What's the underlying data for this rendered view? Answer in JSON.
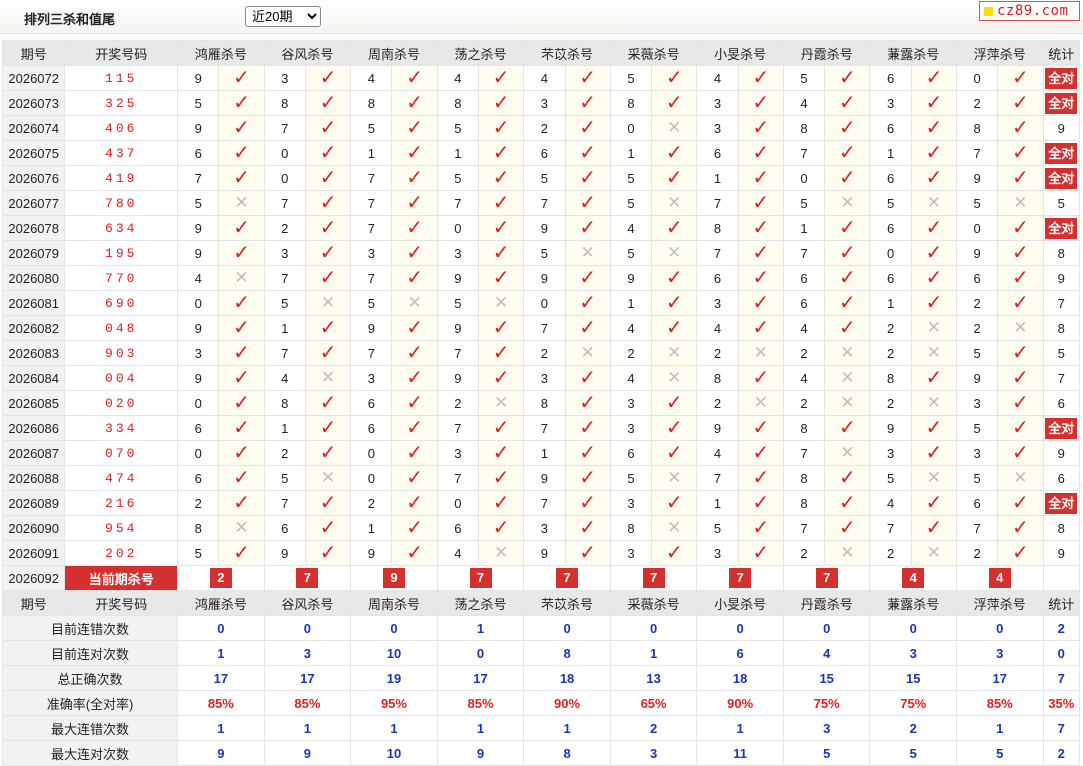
{
  "header": {
    "title": "排列三杀和值尾",
    "period_selected": "近20期",
    "period_options": [
      "近20期"
    ],
    "logo_text": "cz89.com"
  },
  "columns": {
    "issue": "期号",
    "winning": "开奖号码",
    "killers": [
      "鸿雁杀号",
      "谷风杀号",
      "周南杀号",
      "荡之杀号",
      "芣苡杀号",
      "采薇杀号",
      "小旻杀号",
      "丹霞杀号",
      "蒹露杀号",
      "浮萍杀号"
    ],
    "stats": "统计"
  },
  "rows": [
    {
      "issue": "2026072",
      "win": "115",
      "k": [
        [
          "9",
          1
        ],
        [
          "3",
          1
        ],
        [
          "4",
          1
        ],
        [
          "4",
          1
        ],
        [
          "4",
          1
        ],
        [
          "5",
          1
        ],
        [
          "4",
          1
        ],
        [
          "5",
          1
        ],
        [
          "6",
          1
        ],
        [
          "0",
          1
        ]
      ],
      "stat": "全对"
    },
    {
      "issue": "2026073",
      "win": "325",
      "k": [
        [
          "5",
          1
        ],
        [
          "8",
          1
        ],
        [
          "8",
          1
        ],
        [
          "8",
          1
        ],
        [
          "3",
          1
        ],
        [
          "8",
          1
        ],
        [
          "3",
          1
        ],
        [
          "4",
          1
        ],
        [
          "3",
          1
        ],
        [
          "2",
          1
        ]
      ],
      "stat": "全对"
    },
    {
      "issue": "2026074",
      "win": "406",
      "k": [
        [
          "9",
          1
        ],
        [
          "7",
          1
        ],
        [
          "5",
          1
        ],
        [
          "5",
          1
        ],
        [
          "2",
          1
        ],
        [
          "0",
          0
        ],
        [
          "3",
          1
        ],
        [
          "8",
          1
        ],
        [
          "6",
          1
        ],
        [
          "8",
          1
        ]
      ],
      "stat": "9"
    },
    {
      "issue": "2026075",
      "win": "437",
      "k": [
        [
          "6",
          1
        ],
        [
          "0",
          1
        ],
        [
          "1",
          1
        ],
        [
          "1",
          1
        ],
        [
          "6",
          1
        ],
        [
          "1",
          1
        ],
        [
          "6",
          1
        ],
        [
          "7",
          1
        ],
        [
          "1",
          1
        ],
        [
          "7",
          1
        ]
      ],
      "stat": "全对"
    },
    {
      "issue": "2026076",
      "win": "419",
      "k": [
        [
          "7",
          1
        ],
        [
          "0",
          1
        ],
        [
          "7",
          1
        ],
        [
          "5",
          1
        ],
        [
          "5",
          1
        ],
        [
          "5",
          1
        ],
        [
          "1",
          1
        ],
        [
          "0",
          1
        ],
        [
          "6",
          1
        ],
        [
          "9",
          1
        ]
      ],
      "stat": "全对"
    },
    {
      "issue": "2026077",
      "win": "780",
      "k": [
        [
          "5",
          0
        ],
        [
          "7",
          1
        ],
        [
          "7",
          1
        ],
        [
          "7",
          1
        ],
        [
          "7",
          1
        ],
        [
          "5",
          0
        ],
        [
          "7",
          1
        ],
        [
          "5",
          0
        ],
        [
          "5",
          0
        ],
        [
          "5",
          0
        ]
      ],
      "stat": "5"
    },
    {
      "issue": "2026078",
      "win": "634",
      "k": [
        [
          "9",
          1
        ],
        [
          "2",
          1
        ],
        [
          "7",
          1
        ],
        [
          "0",
          1
        ],
        [
          "9",
          1
        ],
        [
          "4",
          1
        ],
        [
          "8",
          1
        ],
        [
          "1",
          1
        ],
        [
          "6",
          1
        ],
        [
          "0",
          1
        ]
      ],
      "stat": "全对"
    },
    {
      "issue": "2026079",
      "win": "195",
      "k": [
        [
          "9",
          1
        ],
        [
          "3",
          1
        ],
        [
          "3",
          1
        ],
        [
          "3",
          1
        ],
        [
          "5",
          0
        ],
        [
          "5",
          0
        ],
        [
          "7",
          1
        ],
        [
          "7",
          1
        ],
        [
          "0",
          1
        ],
        [
          "9",
          1
        ]
      ],
      "stat": "8"
    },
    {
      "issue": "2026080",
      "win": "770",
      "k": [
        [
          "4",
          0
        ],
        [
          "7",
          1
        ],
        [
          "7",
          1
        ],
        [
          "9",
          1
        ],
        [
          "9",
          1
        ],
        [
          "9",
          1
        ],
        [
          "6",
          1
        ],
        [
          "6",
          1
        ],
        [
          "6",
          1
        ],
        [
          "6",
          1
        ]
      ],
      "stat": "9"
    },
    {
      "issue": "2026081",
      "win": "690",
      "k": [
        [
          "0",
          1
        ],
        [
          "5",
          0
        ],
        [
          "5",
          0
        ],
        [
          "5",
          0
        ],
        [
          "0",
          1
        ],
        [
          "1",
          1
        ],
        [
          "3",
          1
        ],
        [
          "6",
          1
        ],
        [
          "1",
          1
        ],
        [
          "2",
          1
        ]
      ],
      "stat": "7"
    },
    {
      "issue": "2026082",
      "win": "048",
      "k": [
        [
          "9",
          1
        ],
        [
          "1",
          1
        ],
        [
          "9",
          1
        ],
        [
          "9",
          1
        ],
        [
          "7",
          1
        ],
        [
          "4",
          1
        ],
        [
          "4",
          1
        ],
        [
          "4",
          1
        ],
        [
          "2",
          0
        ],
        [
          "2",
          0
        ]
      ],
      "stat": "8"
    },
    {
      "issue": "2026083",
      "win": "903",
      "k": [
        [
          "3",
          1
        ],
        [
          "7",
          1
        ],
        [
          "7",
          1
        ],
        [
          "7",
          1
        ],
        [
          "2",
          0
        ],
        [
          "2",
          0
        ],
        [
          "2",
          0
        ],
        [
          "2",
          0
        ],
        [
          "2",
          0
        ],
        [
          "5",
          1
        ]
      ],
      "stat": "5"
    },
    {
      "issue": "2026084",
      "win": "004",
      "k": [
        [
          "9",
          1
        ],
        [
          "4",
          0
        ],
        [
          "3",
          1
        ],
        [
          "9",
          1
        ],
        [
          "3",
          1
        ],
        [
          "4",
          0
        ],
        [
          "8",
          1
        ],
        [
          "4",
          0
        ],
        [
          "8",
          1
        ],
        [
          "9",
          1
        ]
      ],
      "stat": "7"
    },
    {
      "issue": "2026085",
      "win": "020",
      "k": [
        [
          "0",
          1
        ],
        [
          "8",
          1
        ],
        [
          "6",
          1
        ],
        [
          "2",
          0
        ],
        [
          "8",
          1
        ],
        [
          "3",
          1
        ],
        [
          "2",
          0
        ],
        [
          "2",
          0
        ],
        [
          "2",
          0
        ],
        [
          "3",
          1
        ]
      ],
      "stat": "6"
    },
    {
      "issue": "2026086",
      "win": "334",
      "k": [
        [
          "6",
          1
        ],
        [
          "1",
          1
        ],
        [
          "6",
          1
        ],
        [
          "7",
          1
        ],
        [
          "7",
          1
        ],
        [
          "3",
          1
        ],
        [
          "9",
          1
        ],
        [
          "8",
          1
        ],
        [
          "9",
          1
        ],
        [
          "5",
          1
        ]
      ],
      "stat": "全对"
    },
    {
      "issue": "2026087",
      "win": "070",
      "k": [
        [
          "0",
          1
        ],
        [
          "2",
          1
        ],
        [
          "0",
          1
        ],
        [
          "3",
          1
        ],
        [
          "1",
          1
        ],
        [
          "6",
          1
        ],
        [
          "4",
          1
        ],
        [
          "7",
          0
        ],
        [
          "3",
          1
        ],
        [
          "3",
          1
        ]
      ],
      "stat": "9"
    },
    {
      "issue": "2026088",
      "win": "474",
      "k": [
        [
          "6",
          1
        ],
        [
          "5",
          0
        ],
        [
          "0",
          1
        ],
        [
          "7",
          1
        ],
        [
          "9",
          1
        ],
        [
          "5",
          0
        ],
        [
          "7",
          1
        ],
        [
          "8",
          1
        ],
        [
          "5",
          0
        ],
        [
          "5",
          0
        ]
      ],
      "stat": "6"
    },
    {
      "issue": "2026089",
      "win": "216",
      "k": [
        [
          "2",
          1
        ],
        [
          "7",
          1
        ],
        [
          "2",
          1
        ],
        [
          "0",
          1
        ],
        [
          "7",
          1
        ],
        [
          "3",
          1
        ],
        [
          "1",
          1
        ],
        [
          "8",
          1
        ],
        [
          "4",
          1
        ],
        [
          "6",
          1
        ]
      ],
      "stat": "全对"
    },
    {
      "issue": "2026090",
      "win": "954",
      "k": [
        [
          "8",
          0
        ],
        [
          "6",
          1
        ],
        [
          "1",
          1
        ],
        [
          "6",
          1
        ],
        [
          "3",
          1
        ],
        [
          "8",
          0
        ],
        [
          "5",
          1
        ],
        [
          "7",
          1
        ],
        [
          "7",
          1
        ],
        [
          "7",
          1
        ]
      ],
      "stat": "8"
    },
    {
      "issue": "2026091",
      "win": "202",
      "k": [
        [
          "5",
          1
        ],
        [
          "9",
          1
        ],
        [
          "9",
          1
        ],
        [
          "4",
          0
        ],
        [
          "9",
          1
        ],
        [
          "3",
          1
        ],
        [
          "3",
          1
        ],
        [
          "2",
          0
        ],
        [
          "2",
          0
        ],
        [
          "2",
          1
        ]
      ],
      "stat": "9"
    }
  ],
  "current": {
    "issue": "2026092",
    "label": "当前期杀号",
    "k": [
      "2",
      "7",
      "9",
      "7",
      "7",
      "7",
      "7",
      "7",
      "4",
      "4"
    ]
  },
  "summary": [
    {
      "label": "目前连错次数",
      "vals": [
        "0",
        "0",
        "0",
        "1",
        "0",
        "0",
        "0",
        "0",
        "0",
        "0"
      ],
      "stat": "2",
      "pct": false
    },
    {
      "label": "目前连对次数",
      "vals": [
        "1",
        "3",
        "10",
        "0",
        "8",
        "1",
        "6",
        "4",
        "3",
        "3"
      ],
      "stat": "0",
      "pct": false
    },
    {
      "label": "总正确次数",
      "vals": [
        "17",
        "17",
        "19",
        "17",
        "18",
        "13",
        "18",
        "15",
        "15",
        "17"
      ],
      "stat": "7",
      "pct": false
    },
    {
      "label": "准确率(全对率)",
      "vals": [
        "85%",
        "85%",
        "95%",
        "85%",
        "90%",
        "65%",
        "90%",
        "75%",
        "75%",
        "85%"
      ],
      "stat": "35%",
      "pct": true
    },
    {
      "label": "最大连错次数",
      "vals": [
        "1",
        "1",
        "1",
        "1",
        "1",
        "2",
        "1",
        "3",
        "2",
        "1"
      ],
      "stat": "7",
      "pct": false
    },
    {
      "label": "最大连对次数",
      "vals": [
        "9",
        "9",
        "10",
        "9",
        "8",
        "3",
        "11",
        "5",
        "5",
        "5"
      ],
      "stat": "2",
      "pct": false
    }
  ],
  "colors": {
    "accent_red": "#d43030",
    "check_red": "#e02020",
    "stat_blue": "#1a35c0",
    "cross_gray": "#c0c0c0"
  }
}
